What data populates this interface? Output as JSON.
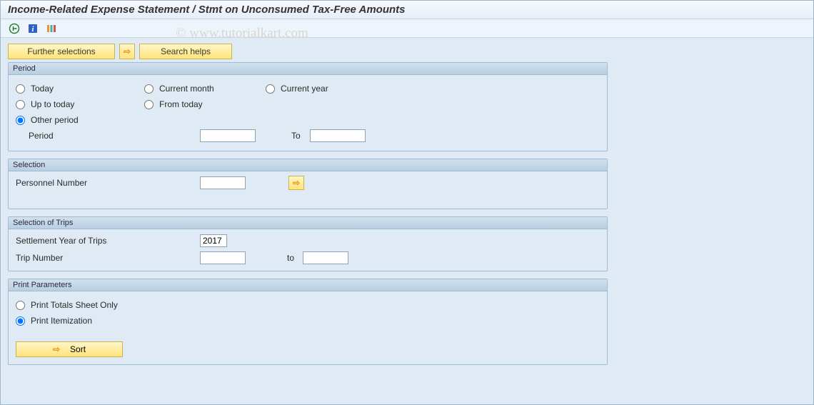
{
  "title": "Income-Related Expense Statement / Stmt on Unconsumed Tax-Free Amounts",
  "watermark": "© www.tutorialkart.com",
  "toolbar": {
    "icons": [
      "execute-icon",
      "information-icon",
      "variant-icon"
    ]
  },
  "buttons": {
    "further_selections": "Further selections",
    "search_helps": "Search helps",
    "sort": "Sort"
  },
  "groups": {
    "period": {
      "title": "Period",
      "options": {
        "today": "Today",
        "current_month": "Current month",
        "current_year": "Current year",
        "up_to_today": "Up to today",
        "from_today": "From today",
        "other_period": "Other period"
      },
      "selected": "other_period",
      "period_label": "Period",
      "period_from": "",
      "to_label": "To",
      "period_to": ""
    },
    "selection": {
      "title": "Selection",
      "personnel_number_label": "Personnel Number",
      "personnel_number": ""
    },
    "trips": {
      "title": "Selection of Trips",
      "settlement_year_label": "Settlement Year of Trips",
      "settlement_year": "2017",
      "trip_number_label": "Trip Number",
      "trip_number_from": "",
      "to_label": "to",
      "trip_number_to": ""
    },
    "print": {
      "title": "Print Parameters",
      "options": {
        "totals_only": "Print Totals Sheet Only",
        "itemization": "Print Itemization"
      },
      "selected": "itemization"
    }
  }
}
